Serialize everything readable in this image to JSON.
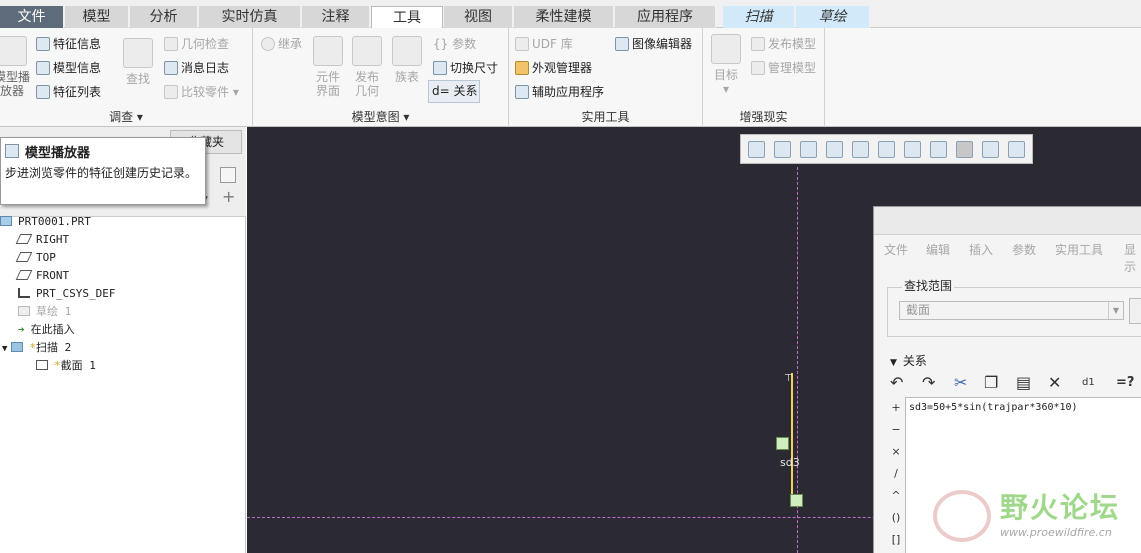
{
  "tabs": [
    "文件",
    "模型",
    "分析",
    "实时仿真",
    "注释",
    "工具",
    "视图",
    "柔性建模",
    "应用程序",
    "扫描",
    "草绘"
  ],
  "ribbon": {
    "investigate": {
      "group_label": "调查",
      "model_player": "模型播放器",
      "feature_info": "特征信息",
      "model_info": "模型信息",
      "feature_list": "特征列表",
      "find": "查找",
      "geometry_check": "几何检查",
      "message_log": "消息日志",
      "compare_part": "比较零件"
    },
    "model_intent": {
      "group_label": "模型意图",
      "inherit": "继承",
      "parameters": "参数",
      "component_interface": "元件界面",
      "publish_geometry": "发布几何",
      "family_table": "族表",
      "switch_dimensions": "切换尺寸",
      "relations": "d= 关系"
    },
    "utilities": {
      "group_label": "实用工具",
      "udf_library": "UDF 库",
      "image_editor": "图像编辑器",
      "appearance_manager": "外观管理器",
      "auxiliary_apps": "辅助应用程序"
    },
    "ar": {
      "group_label": "增强现实",
      "target": "目标",
      "publish_model": "发布模型",
      "manage_model": "管理模型"
    }
  },
  "left_panel": {
    "favorites_tab": "收藏夹",
    "tooltip_title": "模型播放器",
    "tooltip_body": "步进浏览零件的特征创建历史记录。",
    "tree": [
      {
        "label": "PRT0001.PRT",
        "icon": "part-icon",
        "disabled": false
      },
      {
        "label": "RIGHT",
        "icon": "datum-plane-icon",
        "disabled": false
      },
      {
        "label": "TOP",
        "icon": "datum-plane-icon",
        "disabled": false
      },
      {
        "label": "FRONT",
        "icon": "datum-plane-icon",
        "disabled": false
      },
      {
        "label": "PRT_CSYS_DEF",
        "icon": "csys-icon",
        "disabled": false
      },
      {
        "label": "草绘 1",
        "icon": "sketch-icon",
        "disabled": true
      },
      {
        "label": "在此插入",
        "icon": "insert-arrow-icon",
        "disabled": false
      },
      {
        "label": "扫描 2",
        "icon": "sweep-icon",
        "disabled": false
      },
      {
        "label": "截面 1",
        "icon": "section-icon",
        "disabled": false
      }
    ]
  },
  "graphics": {
    "dimension_label": "sd3"
  },
  "relations_dialog": {
    "menu": [
      "文件",
      "编辑",
      "插入",
      "参数",
      "实用工具",
      "显示"
    ],
    "scope_label": "查找范围",
    "scope_value": "截面",
    "relations_header": "关系",
    "operators": [
      "+",
      "−",
      "×",
      "/",
      "^",
      "()",
      "[]"
    ],
    "relation_text": "sd3=50+5*sin(trajpar*360*10)"
  },
  "watermark": {
    "text": "野火论坛",
    "url": "www.proewildfire.cn"
  }
}
